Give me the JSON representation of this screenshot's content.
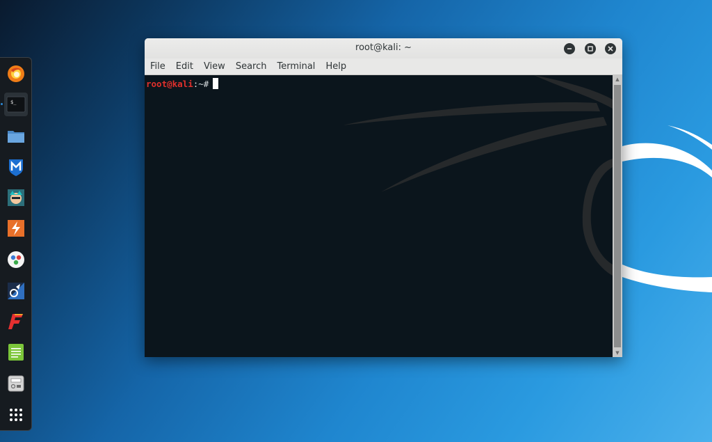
{
  "window": {
    "title": "root@kali: ~",
    "buttons": [
      "minimize",
      "maximize",
      "close"
    ]
  },
  "menubar": {
    "items": [
      "File",
      "Edit",
      "View",
      "Search",
      "Terminal",
      "Help"
    ]
  },
  "terminal": {
    "prompt_user": "root@kali",
    "prompt_rest": ":~#"
  },
  "dock": {
    "items": [
      {
        "name": "firefox-icon"
      },
      {
        "name": "terminal-icon",
        "active": true,
        "glyph": "$_"
      },
      {
        "name": "files-icon"
      },
      {
        "name": "metasploit-icon"
      },
      {
        "name": "armitage-icon"
      },
      {
        "name": "burpsuite-icon"
      },
      {
        "name": "maltego-icon"
      },
      {
        "name": "beef-icon"
      },
      {
        "name": "faraday-icon"
      },
      {
        "name": "leafpad-icon"
      },
      {
        "name": "cherrytree-icon"
      },
      {
        "name": "show-applications-icon"
      }
    ]
  },
  "colors": {
    "prompt_user": "#e0302c",
    "terminal_bg": "#0b151c",
    "dock_bg": "#161b20"
  }
}
